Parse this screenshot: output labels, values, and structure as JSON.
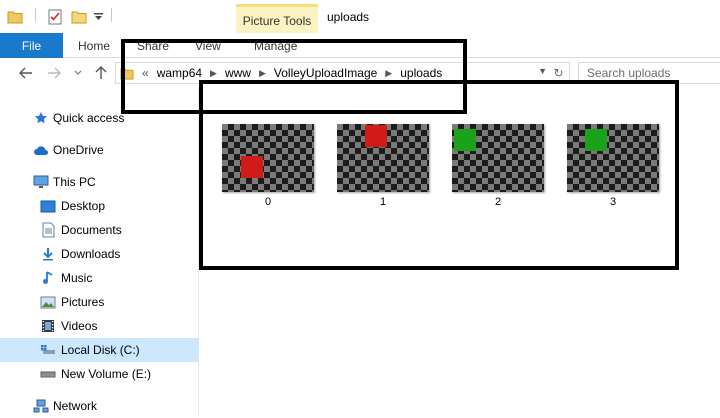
{
  "titlebar": {
    "quick_access_icons": [
      "folder-icon",
      "properties-checklist-icon",
      "new-folder-icon",
      "customize-dropdown-icon"
    ],
    "context_tab_label": "Picture Tools",
    "window_title": "uploads"
  },
  "ribbon": {
    "file_label": "File",
    "tabs": [
      {
        "label": "Home"
      },
      {
        "label": "Share"
      },
      {
        "label": "View"
      },
      {
        "label": "Manage"
      }
    ]
  },
  "address": {
    "overflow": "«",
    "crumbs": [
      "wamp64",
      "www",
      "VolleyUploadImage",
      "uploads"
    ],
    "search_placeholder": "Search uploads"
  },
  "nav": {
    "items": [
      {
        "label": "Quick access",
        "icon": "star-icon"
      },
      {
        "label": "OneDrive",
        "icon": "cloud-icon"
      },
      {
        "label": "This PC",
        "icon": "monitor-icon"
      },
      {
        "label": "Desktop",
        "icon": "desktop-folder-icon"
      },
      {
        "label": "Documents",
        "icon": "documents-icon"
      },
      {
        "label": "Downloads",
        "icon": "download-arrow-icon"
      },
      {
        "label": "Music",
        "icon": "music-note-icon"
      },
      {
        "label": "Pictures",
        "icon": "pictures-icon"
      },
      {
        "label": "Videos",
        "icon": "film-icon"
      },
      {
        "label": "Local Disk (C:)",
        "icon": "windows-drive-icon"
      },
      {
        "label": "New Volume (E:)",
        "icon": "drive-icon"
      },
      {
        "label": "Network",
        "icon": "network-icon"
      }
    ],
    "selected": "Local Disk (C:)"
  },
  "files": [
    {
      "name": "0",
      "square_color": "#d11a1a"
    },
    {
      "name": "1",
      "square_color": "#d11a1a"
    },
    {
      "name": "2",
      "square_color": "#1aa31a"
    },
    {
      "name": "3",
      "square_color": "#1aa31a"
    }
  ],
  "colors": {
    "accent": "#1979ca",
    "selection": "#cce8ff",
    "context_tab": "#fbf4c2",
    "annotation": "#000000"
  }
}
